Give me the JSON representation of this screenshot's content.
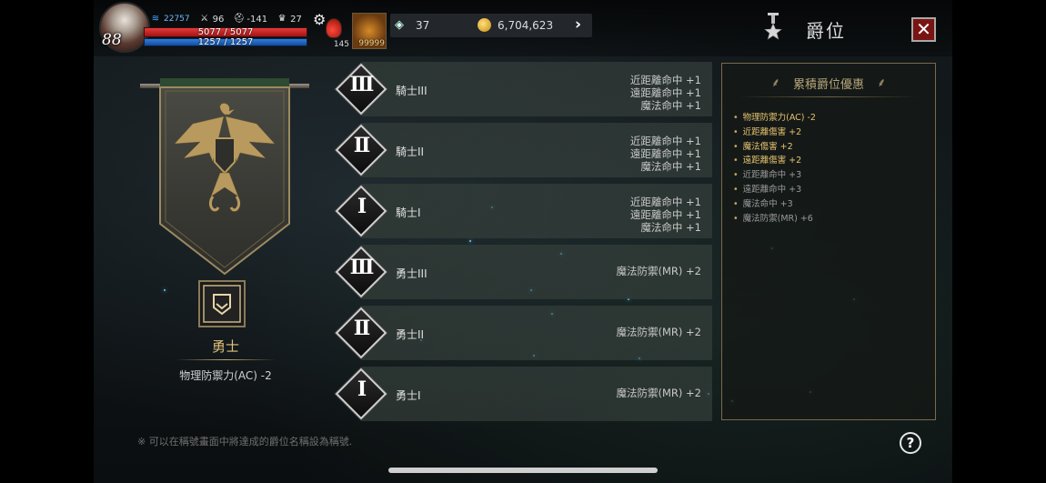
{
  "hud": {
    "level": "88",
    "stats": [
      {
        "icon": "wing-icon",
        "value": "22757"
      },
      {
        "icon": "sword-icon",
        "value": "96"
      },
      {
        "icon": "helmet-icon",
        "value": "-141"
      },
      {
        "icon": "trophy-icon",
        "value": "27"
      }
    ],
    "hp": {
      "text": "5077 / 5077",
      "fraction": 1.0
    },
    "mp": {
      "text": "1257 / 1257",
      "fraction": 1.0
    },
    "potion_count": "145",
    "item_count": "99999",
    "gems": "37",
    "gold": "6,704,623"
  },
  "page": {
    "title": "爵位",
    "footer_note": "※ 可以在稱號畫面中將達成的爵位名稱設為稱號.",
    "help_label": "?",
    "close_label": "✕"
  },
  "current_rank": {
    "name": "勇士",
    "bonus": "物理防禦力(AC) -2"
  },
  "ranks": [
    {
      "numeral": "III",
      "name": "騎士III",
      "bonuses": [
        "近距離命中 +1",
        "遠距離命中 +1",
        "魔法命中 +1"
      ]
    },
    {
      "numeral": "II",
      "name": "騎士II",
      "bonuses": [
        "近距離命中 +1",
        "遠距離命中 +1",
        "魔法命中 +1"
      ]
    },
    {
      "numeral": "I",
      "name": "騎士I",
      "bonuses": [
        "近距離命中 +1",
        "遠距離命中 +1",
        "魔法命中 +1"
      ]
    },
    {
      "numeral": "III",
      "name": "勇士III",
      "bonuses": [
        "魔法防禦(MR) +2"
      ]
    },
    {
      "numeral": "II",
      "name": "勇士II",
      "bonuses": [
        "魔法防禦(MR) +2"
      ]
    },
    {
      "numeral": "I",
      "name": "勇士I",
      "bonuses": [
        "魔法防禦(MR) +2"
      ]
    }
  ],
  "accumulated": {
    "title": "累積爵位優惠",
    "items": [
      {
        "text": "物理防禦力(AC) -2",
        "highlight": true
      },
      {
        "text": "近距離傷害 +2",
        "highlight": true
      },
      {
        "text": "魔法傷害 +2",
        "highlight": true
      },
      {
        "text": "遠距離傷害 +2",
        "highlight": true
      },
      {
        "text": "近距離命中 +3",
        "highlight": false
      },
      {
        "text": "遠距離命中 +3",
        "highlight": false
      },
      {
        "text": "魔法命中 +3",
        "highlight": false
      },
      {
        "text": "魔法防禦(MR) +6",
        "highlight": false
      }
    ]
  },
  "colors": {
    "highlight": "#e6c36e",
    "dim": "#9a9a9a",
    "close_bg": "#7a1414",
    "gold": "#e0c27a"
  }
}
